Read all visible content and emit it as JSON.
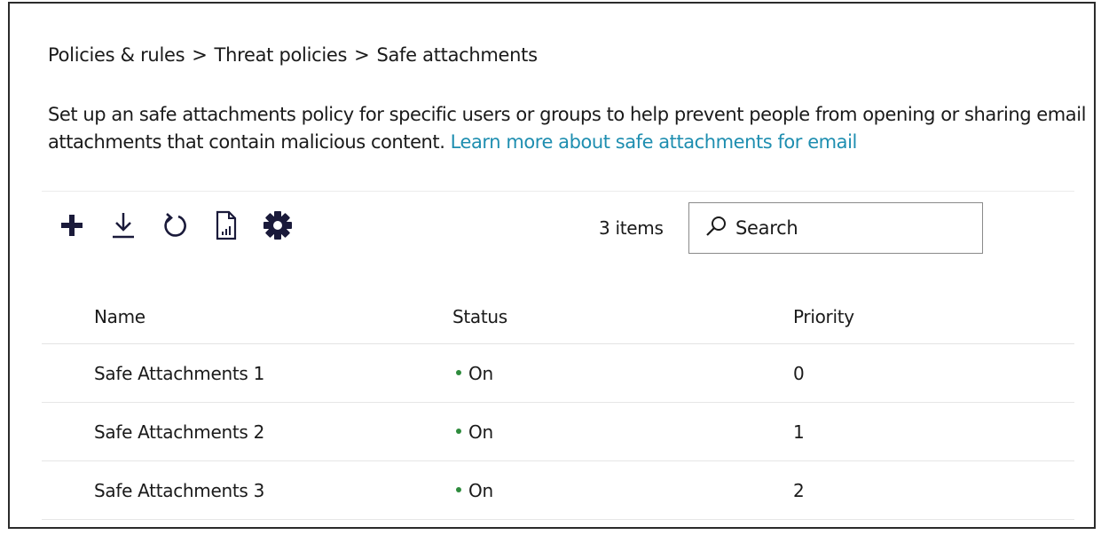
{
  "breadcrumb": {
    "items": [
      "Policies & rules",
      "Threat policies",
      "Safe attachments"
    ],
    "separator": ">"
  },
  "description": {
    "text": "Set up an safe attachments policy for specific users or groups to help prevent people from opening or sharing email attachments that contain malicious content. ",
    "link_text": "Learn more about safe attachments for email"
  },
  "toolbar": {
    "icons": [
      "add-icon",
      "download-icon",
      "refresh-icon",
      "report-icon",
      "settings-icon"
    ]
  },
  "items_count": "3 items",
  "search": {
    "placeholder": "Search"
  },
  "table": {
    "columns": [
      "Name",
      "Status",
      "Priority"
    ],
    "rows": [
      {
        "name": "Safe Attachments 1",
        "status": "On",
        "priority": "0"
      },
      {
        "name": "Safe Attachments 2",
        "status": "On",
        "priority": "1"
      },
      {
        "name": "Safe Attachments 3",
        "status": "On",
        "priority": "2"
      }
    ]
  },
  "colors": {
    "link": "#1e8eb0",
    "status_on": "#2e8b3d",
    "icon": "#1a1a3a"
  }
}
